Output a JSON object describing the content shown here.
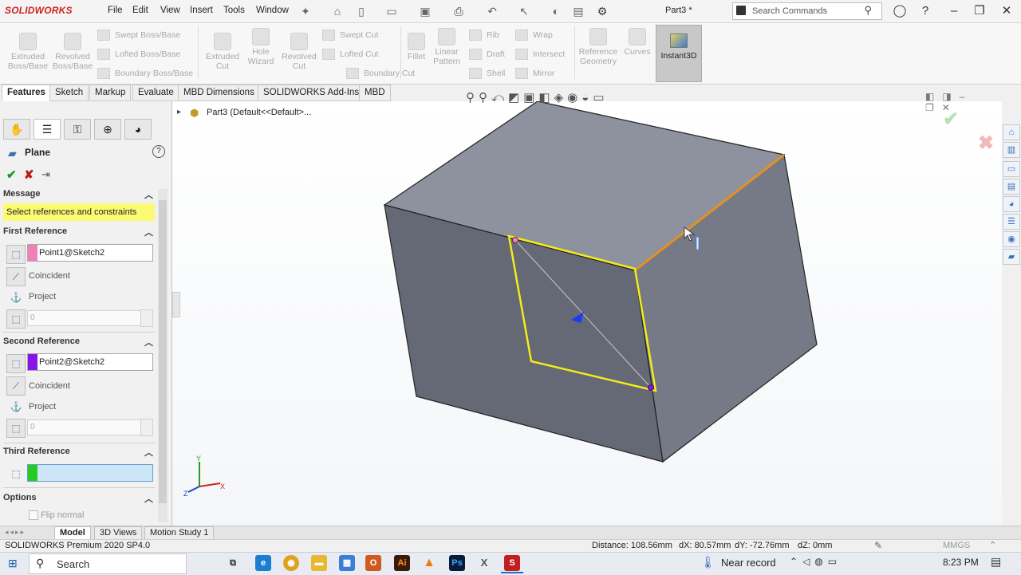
{
  "app": {
    "logo": "SOLIDWORKS",
    "document_title": "Part3 *",
    "menu": [
      "File",
      "Edit",
      "View",
      "Insert",
      "Tools",
      "Window"
    ],
    "search_placeholder": "Search Commands"
  },
  "ribbon": {
    "features": [
      {
        "label": "Extruded Boss/Base"
      },
      {
        "label": "Revolved Boss/Base"
      },
      {
        "label": "Extruded Cut"
      },
      {
        "label": "Hole Wizard"
      },
      {
        "label": "Revolved Cut"
      },
      {
        "label": "Fillet"
      },
      {
        "label": "Linear Pattern"
      },
      {
        "label": "Reference Geometry"
      },
      {
        "label": "Curves"
      }
    ],
    "small": {
      "swept_boss": "Swept Boss/Base",
      "lofted_boss": "Lofted Boss/Base",
      "boundary_boss": "Boundary Boss/Base",
      "swept_cut": "Swept Cut",
      "lofted_cut": "Lofted Cut",
      "boundary_cut": "Boundary Cut",
      "rib": "Rib",
      "draft": "Draft",
      "shell": "Shell",
      "wrap": "Wrap",
      "intersect": "Intersect",
      "mirror": "Mirror"
    },
    "instant3d": "Instant3D"
  },
  "tabs": [
    "Features",
    "Sketch",
    "Markup",
    "Evaluate",
    "MBD Dimensions",
    "SOLIDWORKS Add-Ins",
    "MBD"
  ],
  "tree": {
    "root": "Part3  (Default<<Default>..."
  },
  "property_manager": {
    "title": "Plane",
    "message_header": "Message",
    "message_text": "Select references and constraints",
    "first_ref": {
      "header": "First Reference",
      "value": "Point1@Sketch2",
      "color": "#f080b8",
      "coincident": "Coincident",
      "project": "Project",
      "number": "0"
    },
    "second_ref": {
      "header": "Second Reference",
      "value": "Point2@Sketch2",
      "color": "#8a14e8",
      "coincident": "Coincident",
      "project": "Project",
      "number": "0"
    },
    "third_ref": {
      "header": "Third Reference",
      "color": "#22cc22"
    },
    "options": {
      "header": "Options",
      "flip_normal": "Flip normal"
    }
  },
  "bottom_tabs": [
    "Model",
    "3D Views",
    "Motion Study 1"
  ],
  "status": {
    "version": "SOLIDWORKS Premium 2020 SP4.0",
    "distance": "Distance: 108.56mm",
    "dx": "dX: 80.57mm",
    "dy": "dY: -72.76mm",
    "dz": "dZ: 0mm",
    "units": "MMGS"
  },
  "taskbar": {
    "search": "Search",
    "weather": "Near record",
    "time": "8:23 PM"
  },
  "triad": {
    "x": "X",
    "y": "Y",
    "z": "Z"
  }
}
